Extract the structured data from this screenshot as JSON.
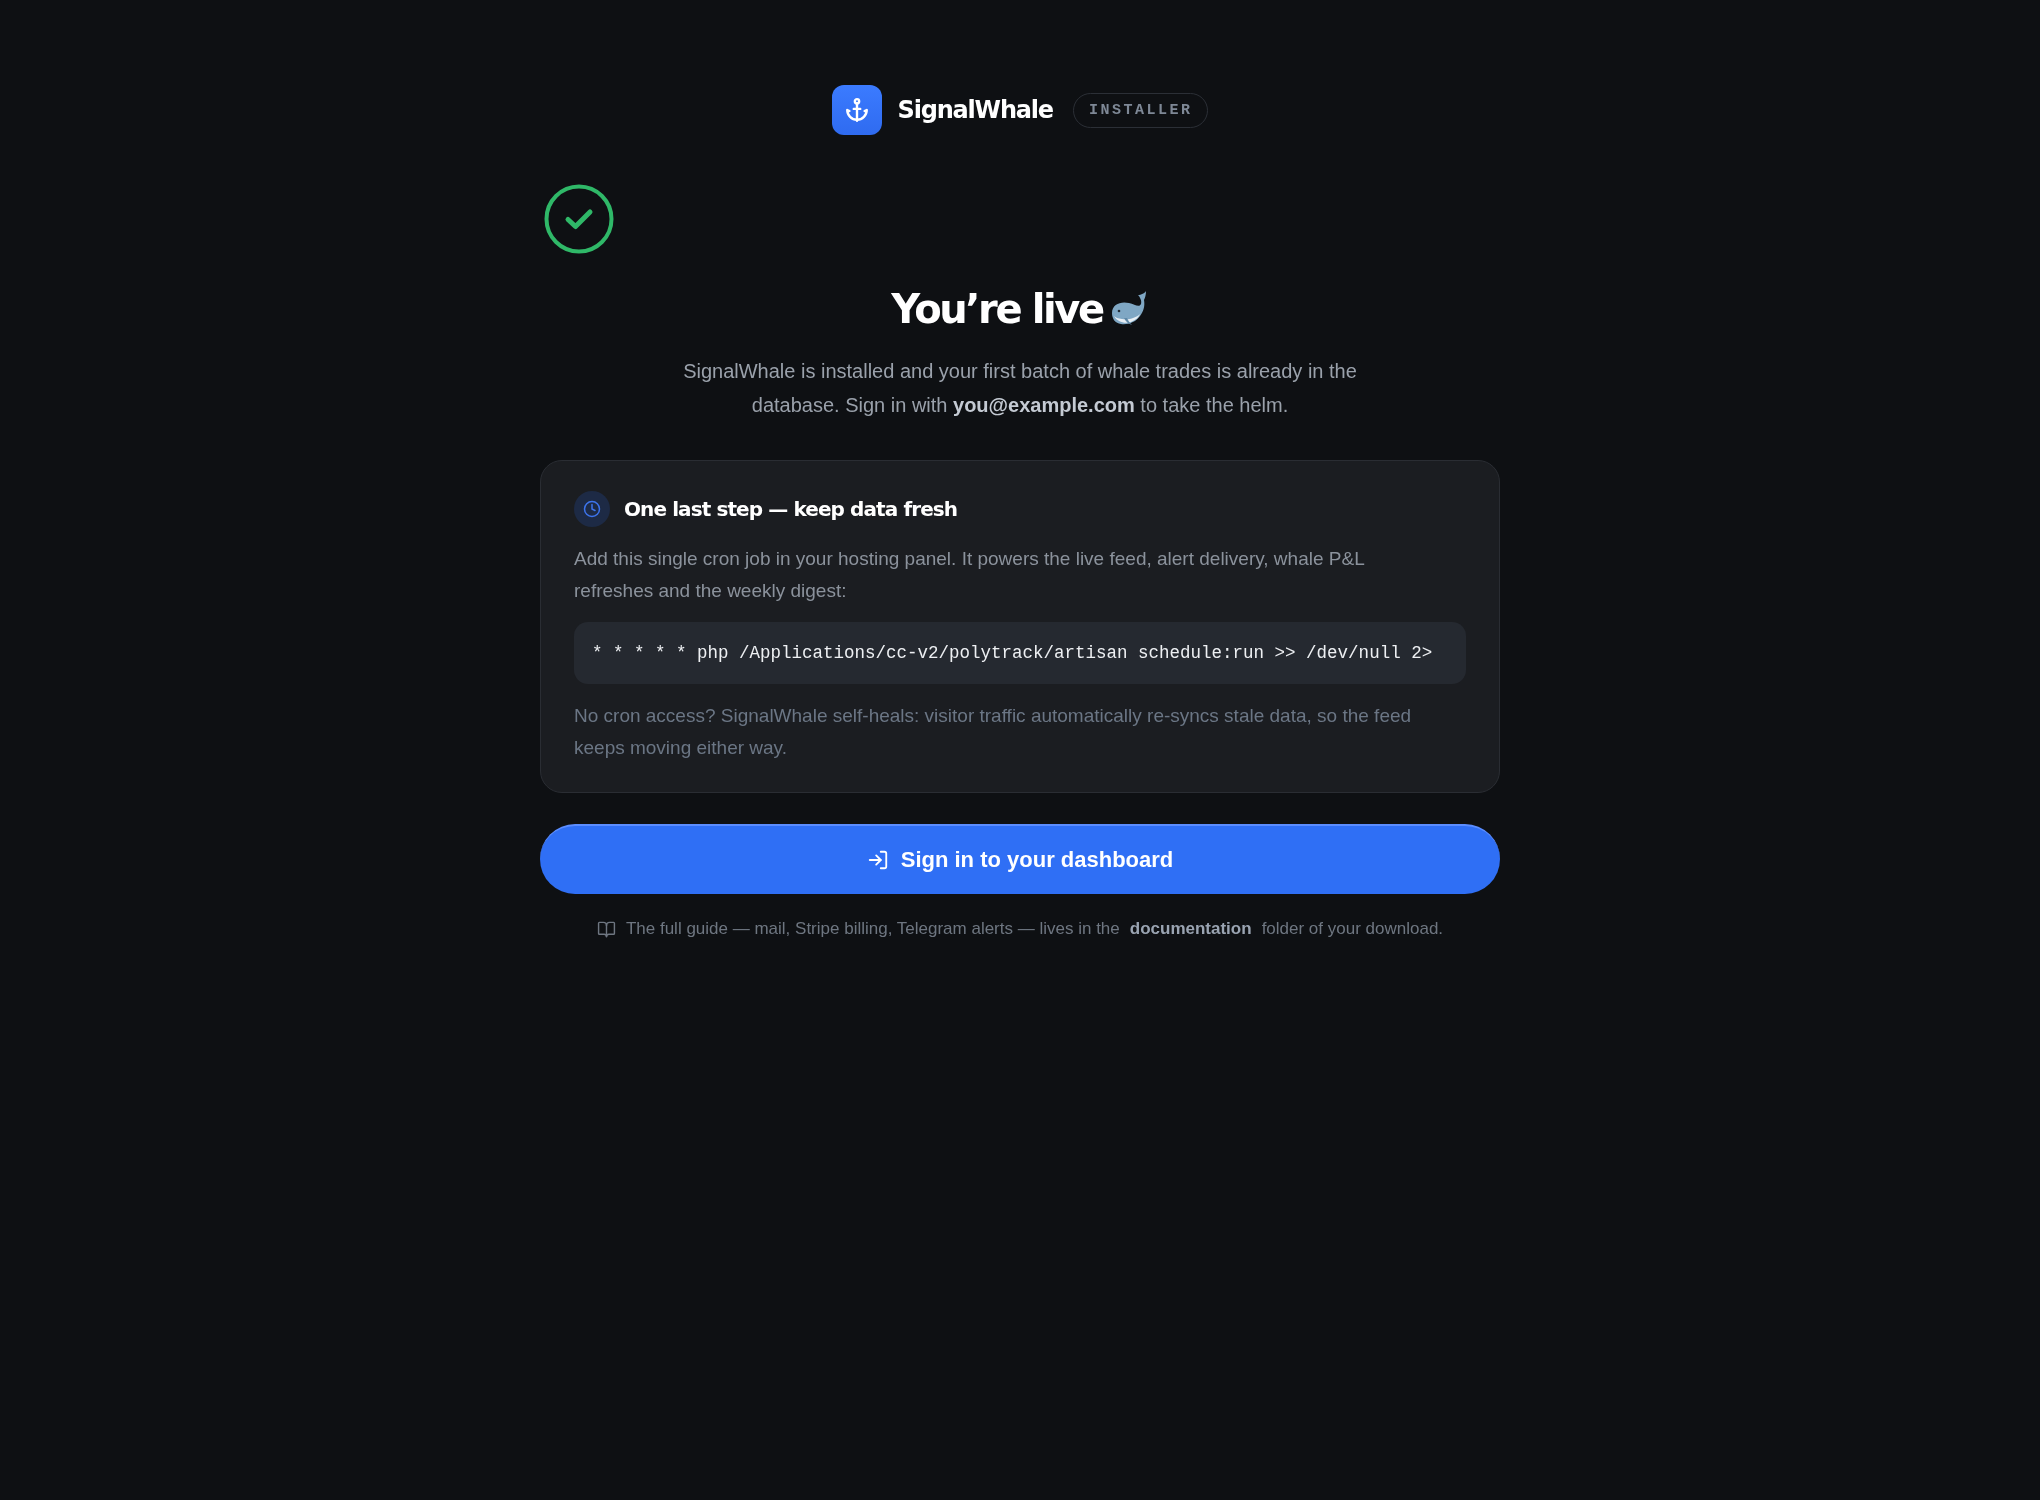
{
  "brand": {
    "name": "SignalWhale",
    "badge": "INSTALLER"
  },
  "hero": {
    "title": "You’re live",
    "subtitle": "SignalWhale is installed and your first batch of whale trades is already in the database. Sign in with **you@example.com** to take the helm."
  },
  "card": {
    "title": "One last step — keep data fresh",
    "description": "Add this single cron job in your hosting panel. It powers the live feed, alert delivery, whale P&L refreshes and the weekly digest:",
    "command": "* * * * * php /Applications/cc-v2/polytrack/artisan schedule:run >> /dev/null 2>",
    "note": "No cron access? SignalWhale self-heals: visitor traffic automatically re-syncs stale data, so the feed keeps moving either way."
  },
  "primary_button": {
    "label": "Sign in to your dashboard"
  },
  "footer": {
    "text_before": "The full guide — mail, Stripe billing, Telegram alerts — lives in the",
    "link": "documentation",
    "text_after": "folder of your download."
  }
}
